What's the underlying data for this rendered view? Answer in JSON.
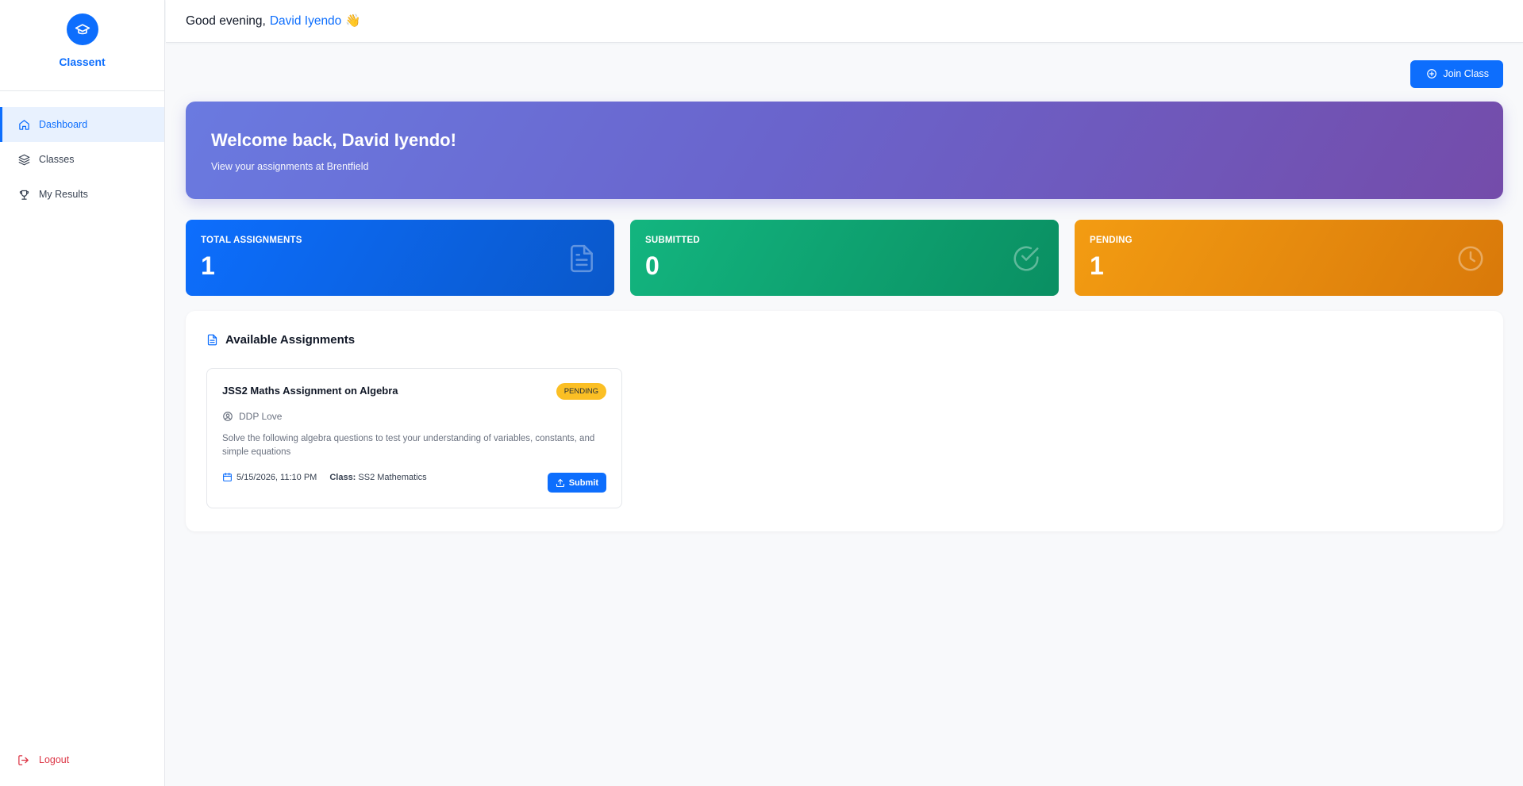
{
  "brand": {
    "name": "Classent"
  },
  "sidebar": {
    "items": [
      {
        "label": "Dashboard",
        "icon": "home-icon",
        "active": true
      },
      {
        "label": "Classes",
        "icon": "layers-icon"
      },
      {
        "label": "My Results",
        "icon": "trophy-icon"
      }
    ],
    "logout_label": "Logout"
  },
  "topbar": {
    "greeting": "Good evening,",
    "user_name": "David Iyendo",
    "emoji": "👋"
  },
  "actions": {
    "join_class_label": "Join Class"
  },
  "welcome": {
    "title": "Welcome back, David Iyendo!",
    "subtitle": "View your assignments at Brentfield"
  },
  "stats": [
    {
      "label": "TOTAL ASSIGNMENTS",
      "value": "1",
      "icon": "document-icon",
      "color": "#0d6efd"
    },
    {
      "label": "SUBMITTED",
      "value": "0",
      "icon": "check-circle-icon",
      "color": "#13b57f"
    },
    {
      "label": "PENDING",
      "value": "1",
      "icon": "clock-icon",
      "color": "#f39c12"
    }
  ],
  "assignments": {
    "title": "Available Assignments",
    "items": [
      {
        "title": "JSS2 Maths Assignment on Algebra",
        "status": "PENDING",
        "teacher": "DDP Love",
        "description": "Solve the following algebra questions to test your understanding of variables, constants, and simple equations",
        "due": "5/15/2026, 11:10 PM",
        "class_label": "Class:",
        "class_name": "SS2 Mathematics",
        "submit_label": "Submit"
      }
    ]
  },
  "colors": {
    "primary": "#0d6efd",
    "danger": "#dc3545",
    "warning": "#fbbf24"
  }
}
